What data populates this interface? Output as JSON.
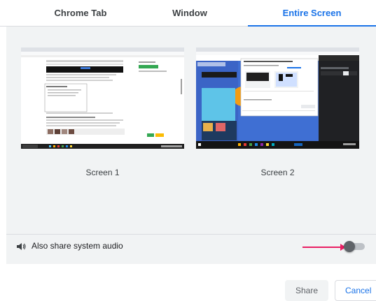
{
  "tabs": [
    {
      "label": "Chrome Tab",
      "active": false
    },
    {
      "label": "Window",
      "active": false
    },
    {
      "label": "Entire Screen",
      "active": true
    }
  ],
  "screens": [
    {
      "label": "Screen 1"
    },
    {
      "label": "Screen 2"
    }
  ],
  "audio": {
    "label": "Also share system audio",
    "enabled": false
  },
  "buttons": {
    "share": "Share",
    "cancel": "Cancel"
  },
  "colors": {
    "accent": "#1a73e8",
    "arrow": "#e91e63",
    "panel": "#f1f3f4"
  }
}
